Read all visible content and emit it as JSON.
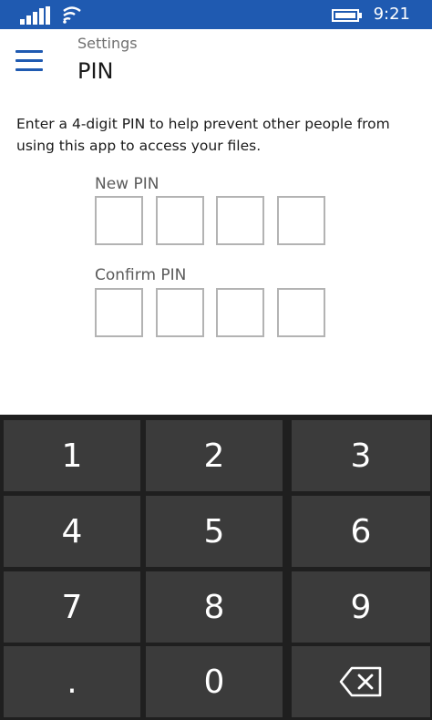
{
  "status_bar": {
    "time": "9:21",
    "signal_icon": "signal-bars-icon",
    "wifi_icon": "wifi-icon",
    "battery_icon": "battery-icon",
    "background": "#1f5ab1"
  },
  "header": {
    "menu_icon": "hamburger-menu-icon",
    "breadcrumb": "Settings",
    "title": "PIN",
    "accent": "#1f5ab1"
  },
  "description": "Enter a 4-digit PIN to help prevent other people from using this app to access your files.",
  "new_pin": {
    "label": "New PIN",
    "digits": 4
  },
  "confirm_pin": {
    "label": "Confirm PIN",
    "digits": 4
  },
  "keypad": {
    "keys": [
      "1",
      "2",
      "3",
      "4",
      "5",
      "6",
      "7",
      "8",
      "9",
      ".",
      "0"
    ],
    "backspace_icon": "backspace-icon",
    "key_color": "#3b3b3b",
    "background": "#1f1f1f"
  }
}
